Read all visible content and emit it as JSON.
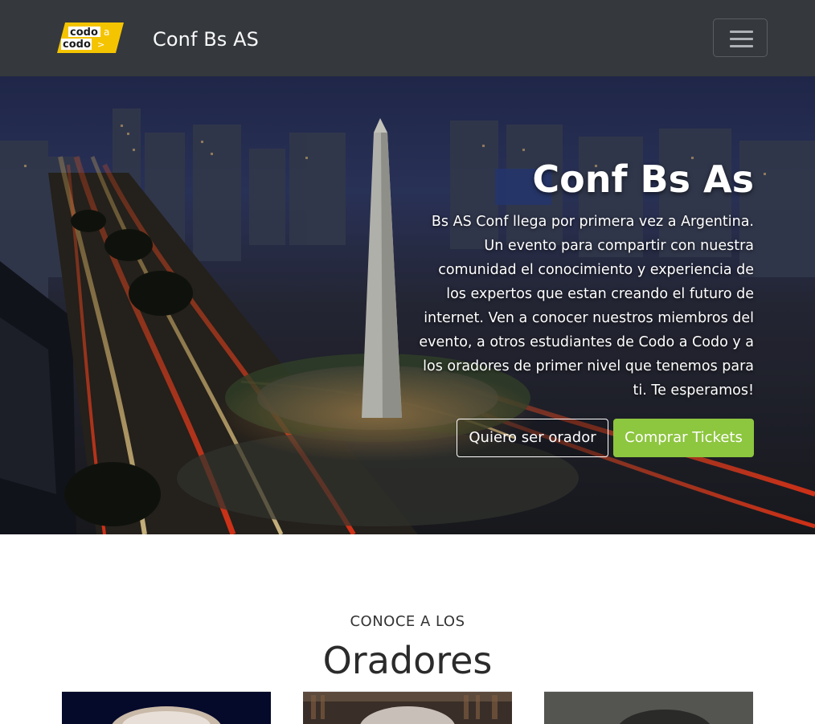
{
  "navbar": {
    "logo": {
      "line1": "codo",
      "line2": "codo",
      "small_a": "a",
      "arrow": ">"
    },
    "brand_title": "Conf Bs AS",
    "menu_toggle_icon": "hamburger-icon"
  },
  "hero": {
    "title": "Conf Bs As",
    "description": "Bs AS Conf llega por primera vez a Argentina. Un evento para compartir con nuestra comunidad el conocimiento y experiencia de los expertos que estan creando el futuro de internet. Ven a conocer nuestros miembros del evento, a otros estudiantes de Codo a Codo y a los oradores de primer nivel que tenemos para ti. Te esperamos!",
    "btn_speaker": "Quiero ser orador",
    "btn_tickets": "Comprar Tickets",
    "background_subject": "Obelisco de Buenos Aires at night"
  },
  "speakers_section": {
    "subtitle": "CONOCE A LOS",
    "title": "Oradores"
  },
  "colors": {
    "navbar_bg": "#35383c",
    "accent_green": "#8dc63f",
    "logo_yellow": "#f5c400"
  }
}
